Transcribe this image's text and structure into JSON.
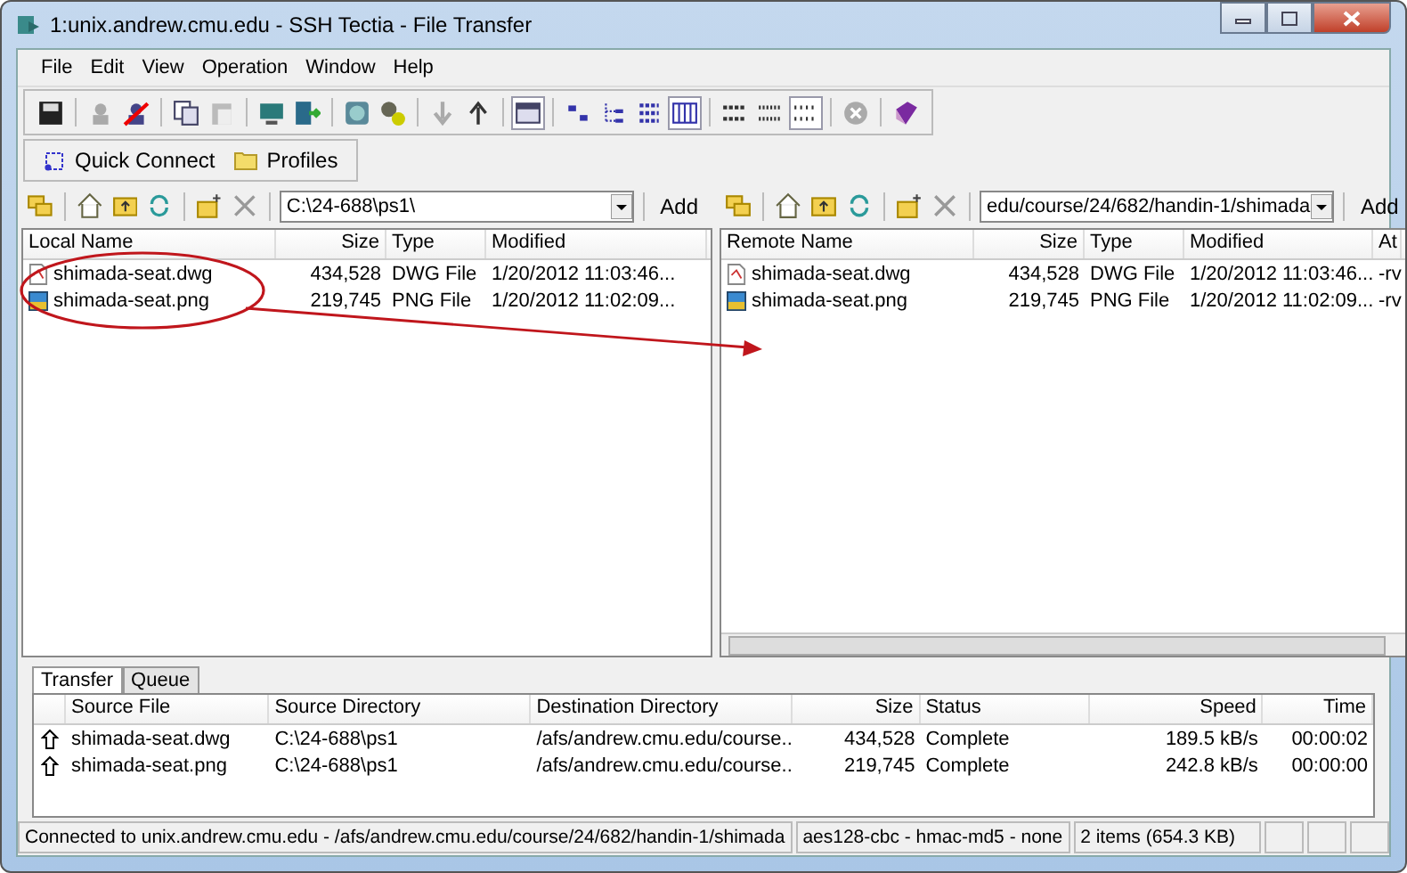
{
  "window": {
    "title": "1:unix.andrew.cmu.edu - SSH Tectia - File Transfer"
  },
  "menu": [
    "File",
    "Edit",
    "View",
    "Operation",
    "Window",
    "Help"
  ],
  "quick_bar": [
    {
      "label": "Quick Connect",
      "kind": "connect"
    },
    {
      "label": "Profiles",
      "kind": "folder"
    }
  ],
  "local": {
    "path": "C:\\24-688\\ps1\\",
    "add": "Add",
    "columns": [
      "Local Name",
      "Size",
      "Type",
      "Modified"
    ],
    "rows": [
      {
        "name": "shimada-seat.dwg",
        "size": "434,528",
        "type": "DWG File",
        "modified": "1/20/2012 11:03:46...",
        "kind": "document"
      },
      {
        "name": "shimada-seat.png",
        "size": "219,745",
        "type": "PNG File",
        "modified": "1/20/2012 11:02:09...",
        "kind": "image"
      }
    ]
  },
  "remote": {
    "path": "edu/course/24/682/handin-1/shimada",
    "add": "Add",
    "columns": [
      "Remote Name",
      "Size",
      "Type",
      "Modified",
      "At"
    ],
    "rows": [
      {
        "name": "shimada-seat.dwg",
        "size": "434,528",
        "type": "DWG File",
        "modified": "1/20/2012 11:03:46...",
        "attr": "-rv",
        "kind": "document"
      },
      {
        "name": "shimada-seat.png",
        "size": "219,745",
        "type": "PNG File",
        "modified": "1/20/2012 11:02:09...",
        "attr": "-rv",
        "kind": "image"
      }
    ]
  },
  "transfer": {
    "tabs": [
      {
        "label": "Transfer",
        "selected": true
      },
      {
        "label": "Queue",
        "selected": false
      }
    ],
    "columns": [
      "Source File",
      "Source Directory",
      "Destination Directory",
      "Size",
      "Status",
      "Speed",
      "Time"
    ],
    "rows": [
      {
        "file": "shimada-seat.dwg",
        "source_dir": "C:\\24-688\\ps1",
        "dest_dir": "/afs/andrew.cmu.edu/course...",
        "size": "434,528",
        "status": "Complete",
        "speed": "189.5 kB/s",
        "time": "00:00:02"
      },
      {
        "file": "shimada-seat.png",
        "source_dir": "C:\\24-688\\ps1",
        "dest_dir": "/afs/andrew.cmu.edu/course...",
        "size": "219,745",
        "status": "Complete",
        "speed": "242.8 kB/s",
        "time": "00:00:00"
      }
    ]
  },
  "status_bar": [
    "Connected to unix.andrew.cmu.edu - /afs/andrew.cmu.edu/course/24/682/handin-1/shimada",
    "aes128-cbc - hmac-md5 - none",
    "2 items (654.3 KB)"
  ]
}
